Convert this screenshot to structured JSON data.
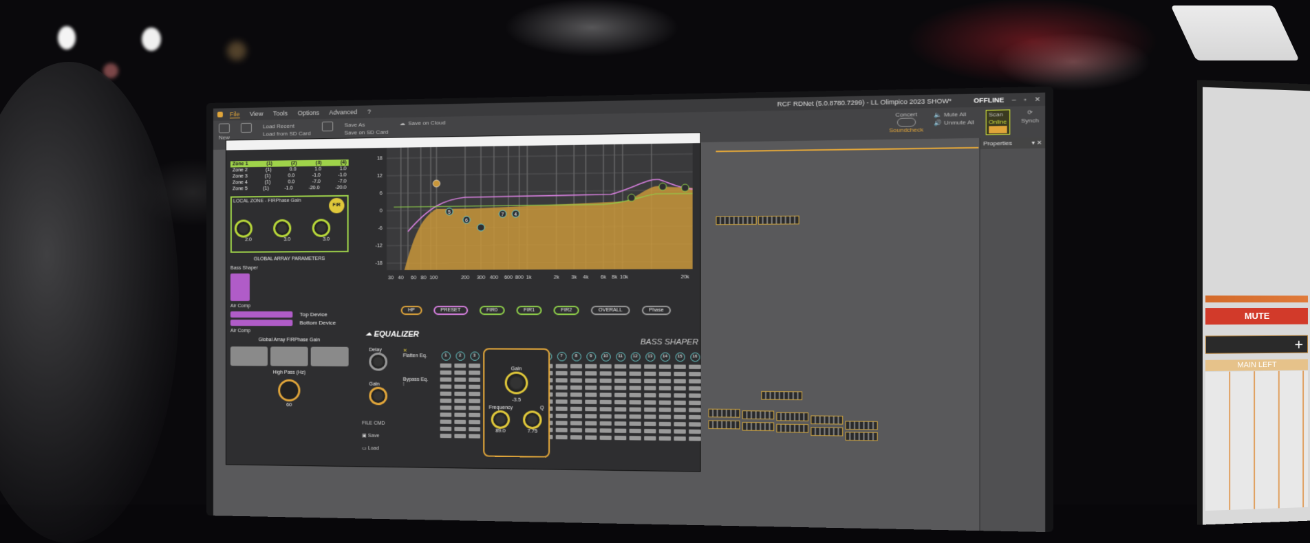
{
  "app": {
    "title": "RCF RDNet (5.0.8780.7299) - LL Olimpico 2023 SHOW*",
    "status": "OFFLINE",
    "menu": [
      "File",
      "View",
      "Tools",
      "Options",
      "Advanced",
      "?"
    ]
  },
  "ribbon": {
    "new": "New",
    "load_recent": "Load Recent",
    "load_sd": "Load from SD Card",
    "save_as": "Save As",
    "save_sd": "Save on SD Card",
    "save_cloud": "Save on Cloud",
    "concert": "Concert",
    "soundcheck": "Soundcheck",
    "mute_all": "Mute All",
    "unmute_all": "Unmute All",
    "scan": "Scan",
    "online": "Online",
    "synch": "Synch"
  },
  "properties": {
    "title": "Properties"
  },
  "plugin": {
    "zones": {
      "headers": [
        "Zone 1",
        "(1)",
        "(2)",
        "(3)",
        "(4)"
      ],
      "rows": [
        [
          "Zone 2",
          "(1)",
          "0.0",
          "1.0",
          "1.0"
        ],
        [
          "Zone 3",
          "(1)",
          "0.0",
          "-1.0",
          "-1.0"
        ],
        [
          "Zone 4",
          "(1)",
          "0.0",
          "-7.0",
          "-7.0"
        ],
        [
          "Zone 5",
          "(1)",
          "-1.0",
          "-20.0",
          "-20.0"
        ]
      ]
    },
    "local_zone_title": "LOCAL ZONE - FIRPhase Gain",
    "fir_badge": "FiR",
    "local_knobs": [
      "2.0",
      "3.0",
      "3.0"
    ],
    "global_array": "GLOBAL ARRAY PARAMETERS",
    "bass_shaper": "Bass Shaper",
    "air_comp": "Air Comp",
    "top_device": "Top Device",
    "bottom_device": "Bottom Device",
    "air_comp2": "Air Comp",
    "global_firphase": "Global Array FIRPhase Gain",
    "high_pass": "High Pass (Hz)",
    "high_pass_value": "60",
    "graph_y_ticks": [
      "18",
      "12",
      "6",
      "0",
      "-6",
      "-12",
      "-18"
    ],
    "graph_x_ticks": [
      "30",
      "40",
      "60",
      "80",
      "100",
      "200",
      "300",
      "400",
      "600",
      "800",
      "1k",
      "2k",
      "3k",
      "4k",
      "6k",
      "8k",
      "10k",
      "20k"
    ],
    "filter_buttons": [
      "HP",
      "PRESET",
      "FIR0",
      "FIR1",
      "FIR2",
      "OVERALL",
      "Phase"
    ],
    "equalizer": "EQUALIZER",
    "bass_shaper_title": "BASS SHAPER",
    "delay": "Delay",
    "flatten_eq": "Flatten Eq.",
    "bypass_eq": "Bypass Eq.",
    "gain": "Gain",
    "file_cmd": "FILE CMD",
    "save": "Save",
    "load": "Load",
    "band_numbers": [
      "1",
      "2",
      "3",
      "4",
      "6",
      "7",
      "8",
      "9",
      "10",
      "11",
      "12",
      "13",
      "14",
      "15",
      "16"
    ],
    "selected_band": {
      "gain_label": "Gain",
      "gain_value": "-3.5",
      "freq_label": "Frequency",
      "freq_value": "89.0",
      "q_label": "Q",
      "q_value": "7.75"
    }
  },
  "side_panel": {
    "mute": "MUTE",
    "add": "+",
    "main_left": "MAIN LEFT"
  }
}
